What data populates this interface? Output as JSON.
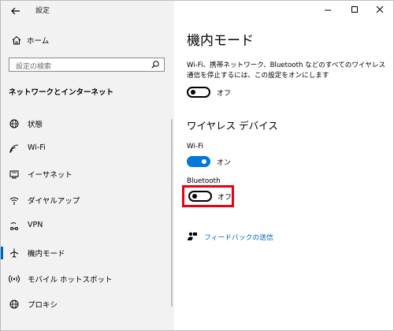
{
  "window": {
    "title": "設定"
  },
  "sidebar": {
    "home_label": "ホーム",
    "search_placeholder": "設定の検索",
    "section_title": "ネットワークとインターネット",
    "items": [
      {
        "label": "状態",
        "icon": "globe-icon"
      },
      {
        "label": "Wi-Fi",
        "icon": "wifi-icon"
      },
      {
        "label": "イーサネット",
        "icon": "ethernet-icon"
      },
      {
        "label": "ダイヤルアップ",
        "icon": "dialup-icon"
      },
      {
        "label": "VPN",
        "icon": "vpn-icon"
      },
      {
        "label": "機内モード",
        "icon": "airplane-icon",
        "active": true
      },
      {
        "label": "モバイル ホットスポット",
        "icon": "hotspot-icon"
      },
      {
        "label": "プロキシ",
        "icon": "globe-icon"
      }
    ]
  },
  "main": {
    "title": "機内モード",
    "description": "Wi-Fi、携帯ネットワーク、Bluetooth などのすべてのワイヤレス通信を停止するには、この設定をオンにします",
    "airplane_toggle_state": "オフ",
    "wireless_heading": "ワイヤレス デバイス",
    "wifi_label": "Wi-Fi",
    "wifi_state": "オン",
    "bluetooth_label": "Bluetooth",
    "bluetooth_state": "オフ",
    "feedback_label": "フィードバックの送信"
  },
  "colors": {
    "accent": "#0078d7",
    "link": "#0063b1",
    "highlight": "#e60012",
    "sidebar_bg": "#f2f2f2"
  }
}
